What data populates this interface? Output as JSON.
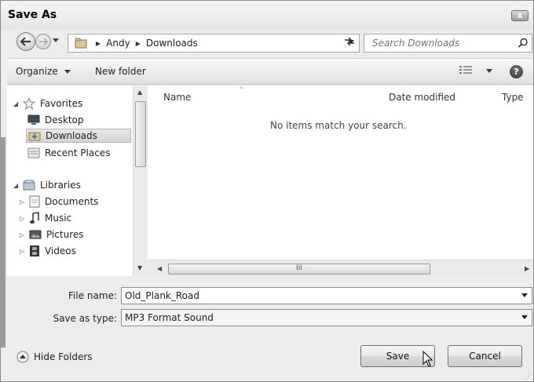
{
  "window": {
    "title": "Save As",
    "close_label": "x"
  },
  "address_bar": {
    "crumbs": [
      "Andy",
      "Downloads"
    ]
  },
  "search": {
    "placeholder": "Search Downloads"
  },
  "toolbar": {
    "organize_label": "Organize",
    "new_folder_label": "New folder",
    "help_label": "?"
  },
  "nav": {
    "favorites": {
      "label": "Favorites",
      "items": [
        "Desktop",
        "Downloads",
        "Recent Places"
      ]
    },
    "libraries": {
      "label": "Libraries",
      "items": [
        "Documents",
        "Music",
        "Pictures",
        "Videos"
      ]
    }
  },
  "file_list": {
    "columns": [
      "Name",
      "Date modified",
      "Type"
    ],
    "empty_message": "No items match your search.",
    "scroll_grip": "III"
  },
  "form": {
    "file_name_label": "File name:",
    "file_name_value": "Old_Plank_Road",
    "save_type_label": "Save as type:",
    "save_type_value": "MP3 Format Sound"
  },
  "footer": {
    "hide_folders_label": "Hide Folders",
    "save_label": "Save",
    "cancel_label": "Cancel"
  }
}
